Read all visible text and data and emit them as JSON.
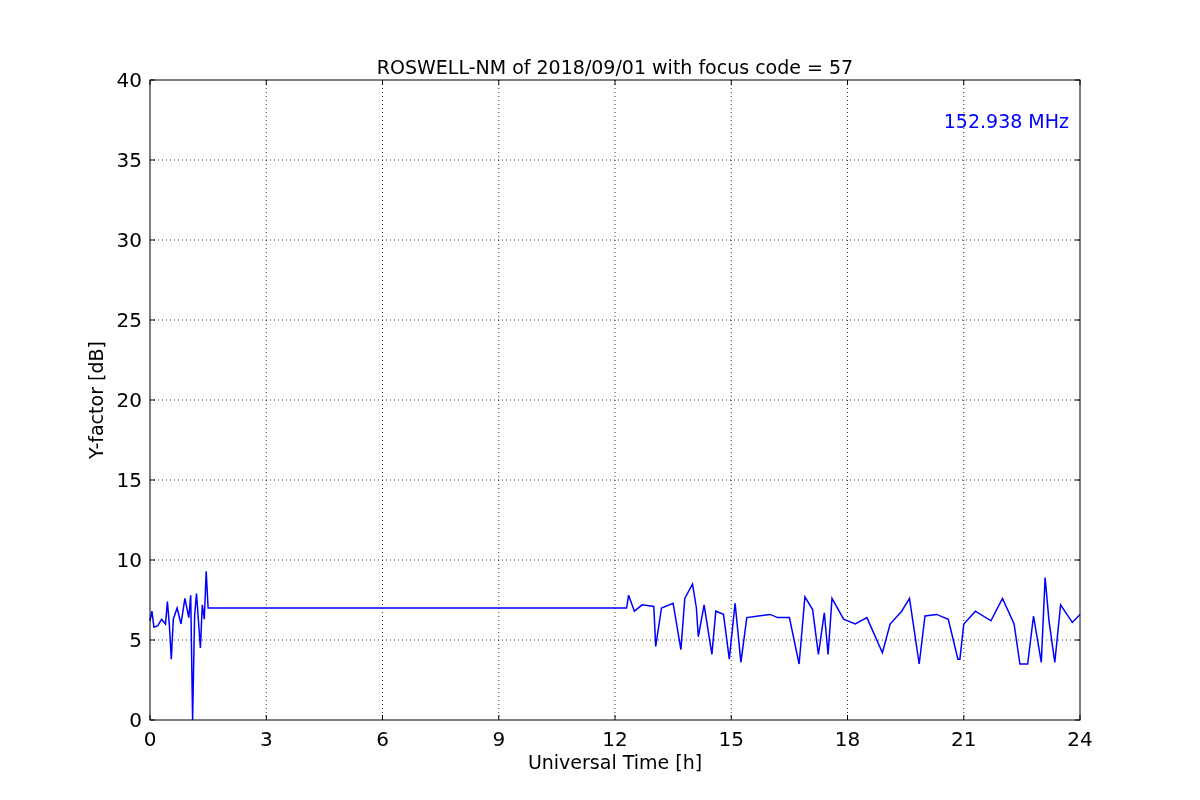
{
  "figure": {
    "chart_data": {
      "type": "line",
      "title": "ROSWELL-NM of 2018/09/01 with focus code = 57",
      "xlabel": "Universal Time [h]",
      "ylabel": "Y-factor [dB]",
      "x": [
        0,
        0.05,
        0.1,
        0.2,
        0.3,
        0.4,
        0.45,
        0.5,
        0.55,
        0.6,
        0.7,
        0.8,
        0.9,
        1.0,
        1.05,
        1.1,
        1.15,
        1.2,
        1.3,
        1.35,
        1.4,
        1.45,
        1.5,
        12.3,
        12.35,
        12.5,
        12.7,
        13.0,
        13.05,
        13.2,
        13.5,
        13.7,
        13.8,
        14.0,
        14.1,
        14.15,
        14.3,
        14.5,
        14.6,
        14.8,
        14.95,
        15.1,
        15.25,
        15.4,
        15.7,
        16.0,
        16.2,
        16.5,
        16.75,
        16.9,
        17.1,
        17.25,
        17.4,
        17.5,
        17.6,
        17.9,
        18.2,
        18.5,
        18.9,
        19.1,
        19.4,
        19.6,
        19.85,
        20.0,
        20.3,
        20.6,
        20.85,
        20.9,
        21.0,
        21.3,
        21.7,
        22.0,
        22.3,
        22.45,
        22.65,
        22.8,
        23.0,
        23.1,
        23.2,
        23.35,
        23.5,
        23.8,
        24.0
      ],
      "series": [
        {
          "color": "#0000ff",
          "values": [
            6.2,
            6.8,
            5.8,
            5.9,
            6.3,
            6.0,
            7.4,
            5.9,
            3.8,
            6.3,
            7.0,
            6.0,
            7.6,
            6.4,
            7.8,
            0,
            6.5,
            7.9,
            4.5,
            7.2,
            6.3,
            9.3,
            7.0,
            7.0,
            7.8,
            6.8,
            7.2,
            7.1,
            4.6,
            7.0,
            7.3,
            4.4,
            7.6,
            8.5,
            7.0,
            5.2,
            7.2,
            4.1,
            6.8,
            6.6,
            3.8,
            7.3,
            3.6,
            6.4,
            6.5,
            6.6,
            6.4,
            6.4,
            3.5,
            7.7,
            6.9,
            4.1,
            6.7,
            4.1,
            7.6,
            6.3,
            6.0,
            6.4,
            4.2,
            6.0,
            6.8,
            7.6,
            3.5,
            6.5,
            6.6,
            6.3,
            3.8,
            3.8,
            6.0,
            6.8,
            6.2,
            7.6,
            6.0,
            3.5,
            3.5,
            6.5,
            3.6,
            8.9,
            6.2,
            3.6,
            7.2,
            6.1,
            6.6
          ]
        }
      ],
      "xlim": [
        0,
        24
      ],
      "ylim": [
        0,
        40
      ],
      "xticks": [
        0,
        3,
        6,
        9,
        12,
        15,
        18,
        21,
        24
      ],
      "yticks": [
        0,
        5,
        10,
        15,
        20,
        25,
        30,
        35,
        40
      ],
      "grid": true,
      "annotations": [
        {
          "text": "152.938 MHz"
        }
      ]
    }
  }
}
